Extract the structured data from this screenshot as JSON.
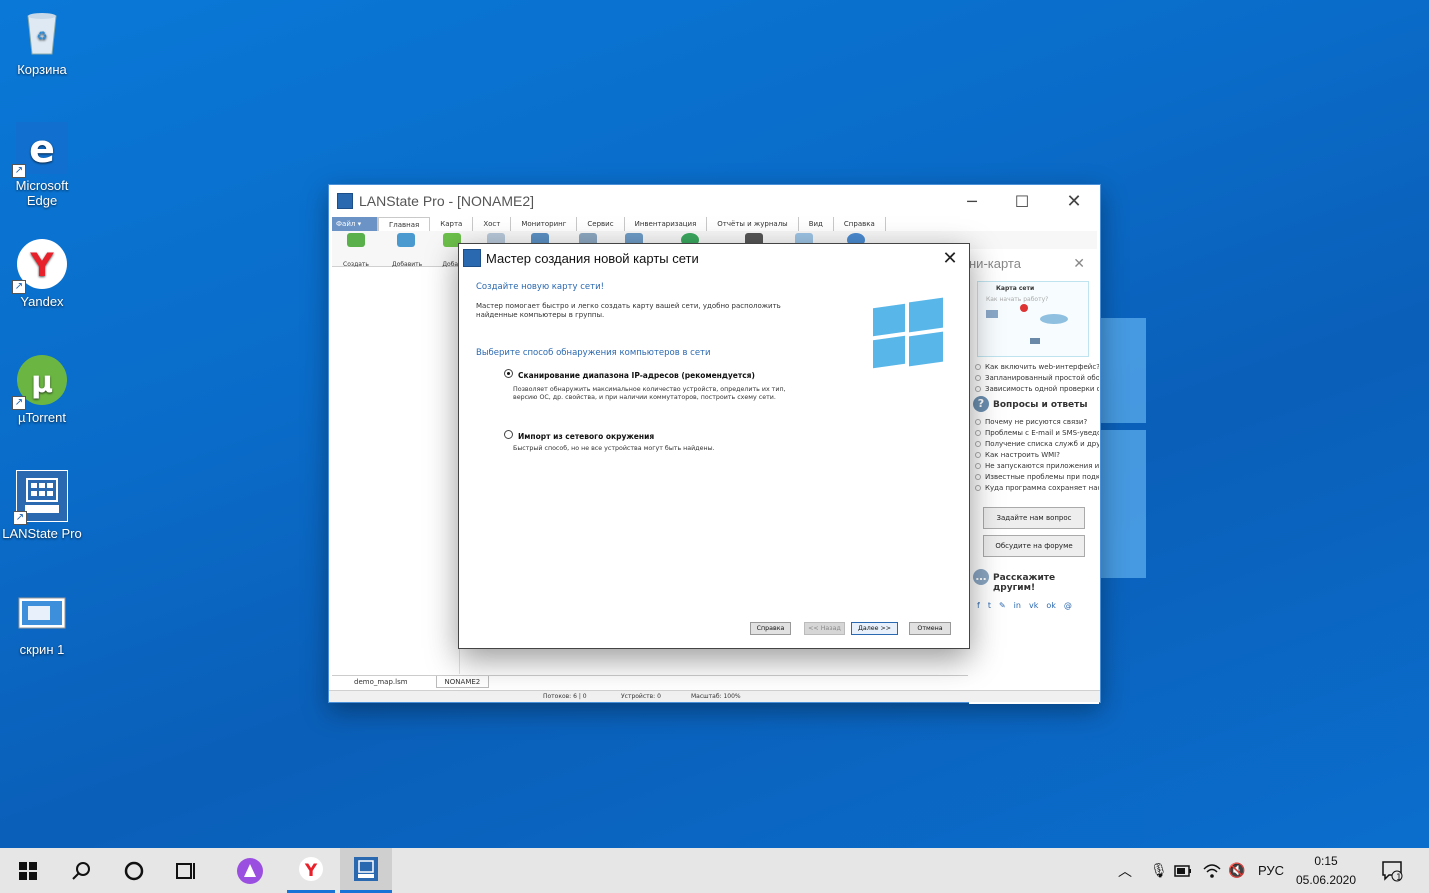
{
  "desktop": {
    "icons": [
      {
        "label": "Корзина"
      },
      {
        "label": "Microsoft Edge"
      },
      {
        "label": "Yandex"
      },
      {
        "label": "µTorrent"
      },
      {
        "label": "LANState Pro"
      },
      {
        "label": "скрин 1"
      }
    ]
  },
  "main_window": {
    "title": "LANState Pro - [NONAME2]",
    "ribbon_tabs": [
      "Файл",
      "Главная",
      "Карта",
      "Хост",
      "Мониторинг",
      "Сервис",
      "Инвентаризация",
      "Отчёты и журналы",
      "Вид",
      "Справка"
    ],
    "ribbon_buttons": [
      "Создать",
      "Добавить",
      "Добав"
    ],
    "right_pane": {
      "title": "ни-карта",
      "mini_map_label": "Карта сети",
      "mini_map_overlay": "Как начать работу?",
      "tips": [
        "Как включить web-интерфейс?",
        "Запланированный простой обор...",
        "Зависимость одной проверки от ..."
      ],
      "faq_title": "Вопросы и ответы",
      "faq": [
        "Почему не рисуются связи?",
        "Проблемы с E-mail и SMS-уведом...",
        "Получение списка служб и друго...",
        "Как настроить WMI?",
        "Не запускаются приложения из м...",
        "Известные проблемы при подкл...",
        "Куда программа сохраняет наоп..."
      ],
      "ask_button": "Задайте нам вопрос",
      "forum_button": "Обсудите на форуме",
      "share_title": "Расскажите другим!"
    },
    "doc_tabs": [
      "demo_map.lsm",
      "NONAME2"
    ],
    "status": {
      "threads": "Потоков: 6 | 0",
      "devices": "Устройств: 0",
      "scale": "Масштаб: 100%"
    }
  },
  "wizard": {
    "title": "Мастер создания новой карты сети",
    "heading": "Создайте новую карту сети!",
    "description": "Мастер помогает быстро и легко создать карту вашей сети, удобно расположить найденные компьютеры в группы.",
    "subheading": "Выберите способ обнаружения компьютеров в сети",
    "options": [
      {
        "label": "Сканирование диапазона IP-адресов (рекомендуется)",
        "description": "Позволяет обнаружить максимальное количество устройств, определить их тип, версию ОС, др. свойства, и при наличии коммутаторов, построить схему сети.",
        "selected": true
      },
      {
        "label": "Импорт из сетевого окружения",
        "description": "Быстрый способ, но не все устройства могут быть найдены.",
        "selected": false
      }
    ],
    "buttons": {
      "help": "Справка",
      "back": "<< Назад",
      "next": "Далее >>",
      "cancel": "Отмена"
    }
  },
  "taskbar": {
    "language": "РУС",
    "time": "0:15",
    "date": "05.06.2020",
    "notification_count": "1"
  },
  "colors": {
    "accent": "#2a68b0",
    "desktop": "#0a6cc9",
    "taskbar": "#e6e6e6"
  }
}
